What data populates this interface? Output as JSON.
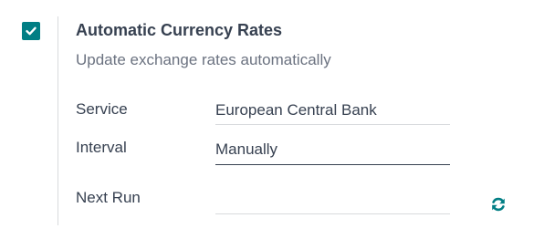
{
  "setting": {
    "enabled": true,
    "title": "Automatic Currency Rates",
    "description": "Update exchange rates automatically"
  },
  "fields": {
    "service": {
      "label": "Service",
      "value": "European Central Bank"
    },
    "interval": {
      "label": "Interval",
      "value": "Manually"
    },
    "next_run": {
      "label": "Next Run",
      "value": ""
    }
  },
  "icons": {
    "checkbox": "check-icon",
    "refresh": "refresh-icon"
  },
  "colors": {
    "accent": "#017e84",
    "text": "#374151",
    "muted": "#6b7280",
    "border": "#d8dadd"
  }
}
